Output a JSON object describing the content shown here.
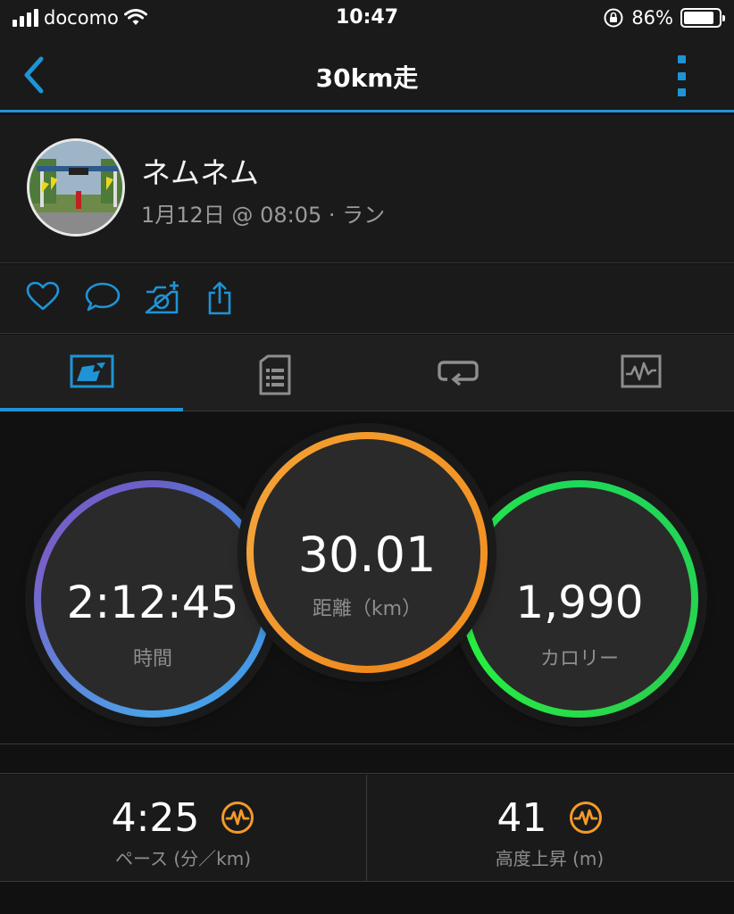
{
  "status_bar": {
    "carrier": "docomo",
    "time": "10:47",
    "battery_percent": "86%",
    "battery_level": 0.86,
    "icons": [
      "signal-icon",
      "wifi-icon",
      "rotation-lock-icon",
      "battery-icon"
    ]
  },
  "nav": {
    "title": "30km走",
    "back_icon": "chevron-left-icon",
    "more_icon": "more-vertical-icon"
  },
  "activity": {
    "user_name": "ネムネム",
    "meta": "1月12日 @ 08:05 · ラン"
  },
  "actions": [
    "heart-icon",
    "comment-icon",
    "add-photo-icon",
    "share-icon"
  ],
  "tabs": [
    {
      "icon": "summary-icon",
      "active": true
    },
    {
      "icon": "details-icon",
      "active": false
    },
    {
      "icon": "laps-icon",
      "active": false
    },
    {
      "icon": "charts-icon",
      "active": false
    }
  ],
  "metrics": {
    "time": {
      "value": "2:12:45",
      "label": "時間"
    },
    "distance": {
      "value": "30.01",
      "label": "距離（km）"
    },
    "calories": {
      "value": "1,990",
      "label": "カロリー"
    }
  },
  "stats": {
    "pace": {
      "value": "4:25",
      "label": "ペース (分／km)",
      "icon": "pulse-icon"
    },
    "elevation": {
      "value": "41",
      "label": "高度上昇 (m)",
      "icon": "pulse-icon"
    }
  },
  "colors": {
    "accent": "#1e94d6",
    "time_ring": "#4aa3e8",
    "distance_ring": "#f39a2a",
    "calories_ring": "#26f040",
    "badge": "#f39a2a"
  }
}
